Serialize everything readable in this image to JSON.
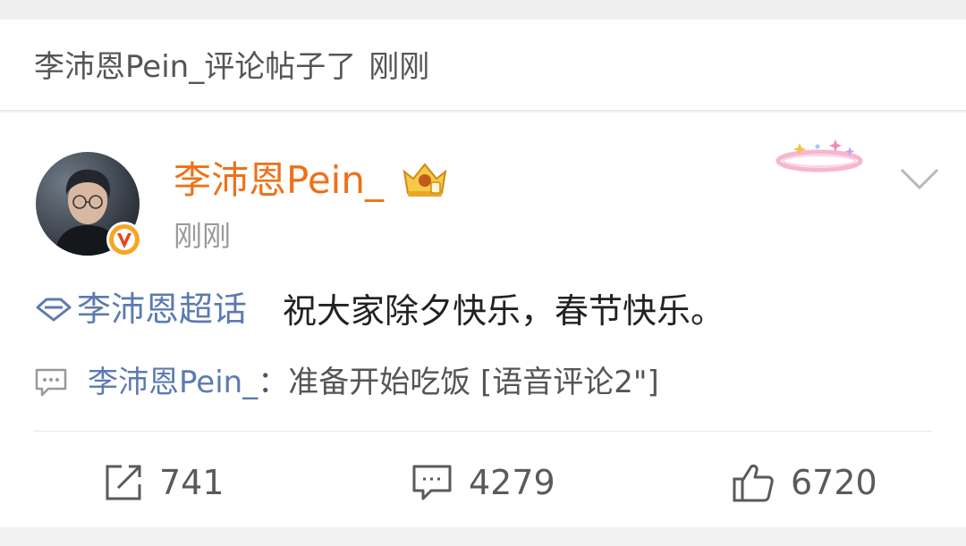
{
  "activity": {
    "message": "李沛恩Pein_评论帖子了",
    "time": "刚刚"
  },
  "post": {
    "username": "李沛恩Pein_",
    "time": "刚刚",
    "topic": "李沛恩超话",
    "text": "祝大家除夕快乐，春节快乐。",
    "comment_preview": {
      "user": "李沛恩Pein_",
      "separator": "：",
      "text": "准备开始吃饭 [语音评论2\"]"
    },
    "actions": {
      "reposts": "741",
      "comments": "4279",
      "likes": "6720"
    }
  },
  "icons": {
    "verified": "verified-v-badge-icon",
    "crown": "crown-member-badge-icon",
    "decoration": "halo-decoration-icon",
    "more": "chevron-down-icon",
    "topic": "diamond-topic-icon",
    "comment_preview": "comment-bubble-icon",
    "repost": "share-icon",
    "comment": "comment-icon",
    "like": "thumbs-up-icon"
  },
  "colors": {
    "username": "#f07018",
    "link": "#5b7bb0",
    "verified_badge": "#f5a623"
  }
}
